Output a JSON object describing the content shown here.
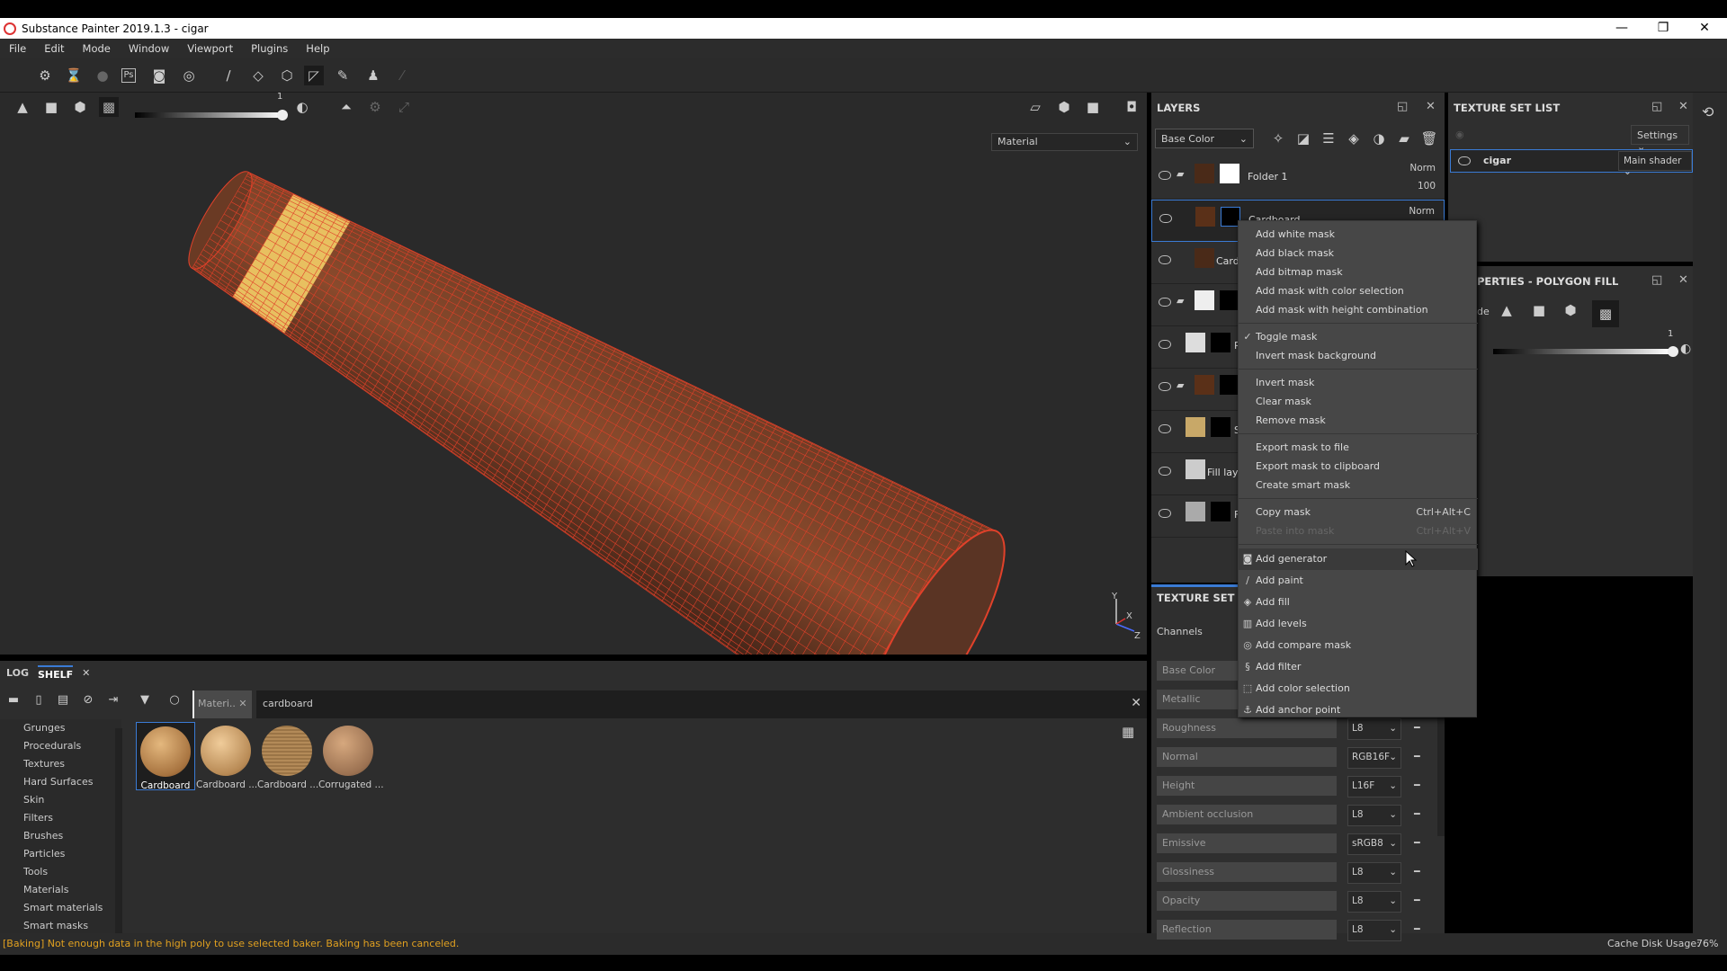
{
  "window": {
    "title": "Substance Painter 2019.1.3 - cigar",
    "minimize": "—",
    "restore": "❐",
    "close": "✕"
  },
  "menu": [
    "File",
    "Edit",
    "Mode",
    "Window",
    "Viewport",
    "Plugins",
    "Help"
  ],
  "viewport": {
    "slider_value": "1",
    "material_mode": "Material",
    "gizmo_y": "Y",
    "gizmo_x": "X",
    "gizmo_z": "Z",
    "wire_color": "#e0412a"
  },
  "shelf": {
    "tabs": [
      "LOG",
      "SHELF"
    ],
    "filter_tag": "Materi..",
    "search": "cardboard",
    "categories": [
      "Grunges",
      "Procedurals",
      "Textures",
      "Hard Surfaces",
      "Skin",
      "Filters",
      "Brushes",
      "Particles",
      "Tools",
      "Materials",
      "Smart materials",
      "Smart masks"
    ],
    "items": [
      "Cardboard",
      "Cardboard ...",
      "Cardboard ...",
      "Corrugated ..."
    ]
  },
  "status": {
    "message": "[Baking] Not enough data in the high poly to use selected baker. Baking has been canceled.",
    "message_color": "#e0a020",
    "cache_label": "Cache Disk Usage:",
    "cache_value": "76%"
  },
  "layers": {
    "title": "LAYERS",
    "channel": "Base Color",
    "rows": [
      {
        "name": "Folder 1",
        "blend": "Norm",
        "opacity": "100"
      },
      {
        "name": "Cardboard",
        "blend": "Norm"
      },
      {
        "name": "Card"
      },
      {
        "name": ""
      },
      {
        "name": "Pa"
      },
      {
        "name": ""
      },
      {
        "name": "Sa"
      },
      {
        "name": "Fill layer"
      },
      {
        "name": "Fi"
      }
    ]
  },
  "texture_set_list": {
    "title": "TEXTURE SET LIST",
    "settings": "Settings",
    "set_name": "cigar",
    "shader": "Main shader"
  },
  "properties": {
    "title": "PERTIES - POLYGON FILL",
    "mode_label": "de",
    "slider_value": "1"
  },
  "texture_set_settings": {
    "title": "TEXTURE SET SET",
    "channels_label": "Channels",
    "channels": [
      {
        "name": "Base Color",
        "format": ""
      },
      {
        "name": "Metallic",
        "format": ""
      },
      {
        "name": "Roughness",
        "format": "L8"
      },
      {
        "name": "Normal",
        "format": "RGB16F"
      },
      {
        "name": "Height",
        "format": "L16F"
      },
      {
        "name": "Ambient occlusion",
        "format": "L8"
      },
      {
        "name": "Emissive",
        "format": "sRGB8"
      },
      {
        "name": "Glossiness",
        "format": "L8"
      },
      {
        "name": "Opacity",
        "format": "L8"
      },
      {
        "name": "Reflection",
        "format": "L8"
      }
    ]
  },
  "context_menu": {
    "groups": [
      [
        {
          "label": "Add white mask"
        },
        {
          "label": "Add black mask"
        },
        {
          "label": "Add bitmap mask"
        },
        {
          "label": "Add mask with color selection"
        },
        {
          "label": "Add mask with height combination"
        }
      ],
      [
        {
          "label": "Toggle mask",
          "checked": true
        },
        {
          "label": "Invert mask background"
        }
      ],
      [
        {
          "label": "Invert mask"
        },
        {
          "label": "Clear mask"
        },
        {
          "label": "Remove mask"
        }
      ],
      [
        {
          "label": "Export mask to file"
        },
        {
          "label": "Export mask to clipboard"
        },
        {
          "label": "Create smart mask"
        }
      ],
      [
        {
          "label": "Copy mask",
          "shortcut": "Ctrl+Alt+C"
        },
        {
          "label": "Paste into mask",
          "shortcut": "Ctrl+Alt+V",
          "disabled": true
        }
      ],
      [
        {
          "label": "Add generator",
          "icon": "generator-icon",
          "hover": true
        },
        {
          "label": "Add paint",
          "icon": "paint-icon"
        },
        {
          "label": "Add fill",
          "icon": "fill-icon"
        },
        {
          "label": "Add levels",
          "icon": "levels-icon"
        },
        {
          "label": "Add compare mask",
          "icon": "compare-mask-icon"
        },
        {
          "label": "Add filter",
          "icon": "filter-icon"
        },
        {
          "label": "Add color selection",
          "icon": "color-selection-icon"
        },
        {
          "label": "Add anchor point",
          "icon": "anchor-icon"
        }
      ]
    ]
  }
}
